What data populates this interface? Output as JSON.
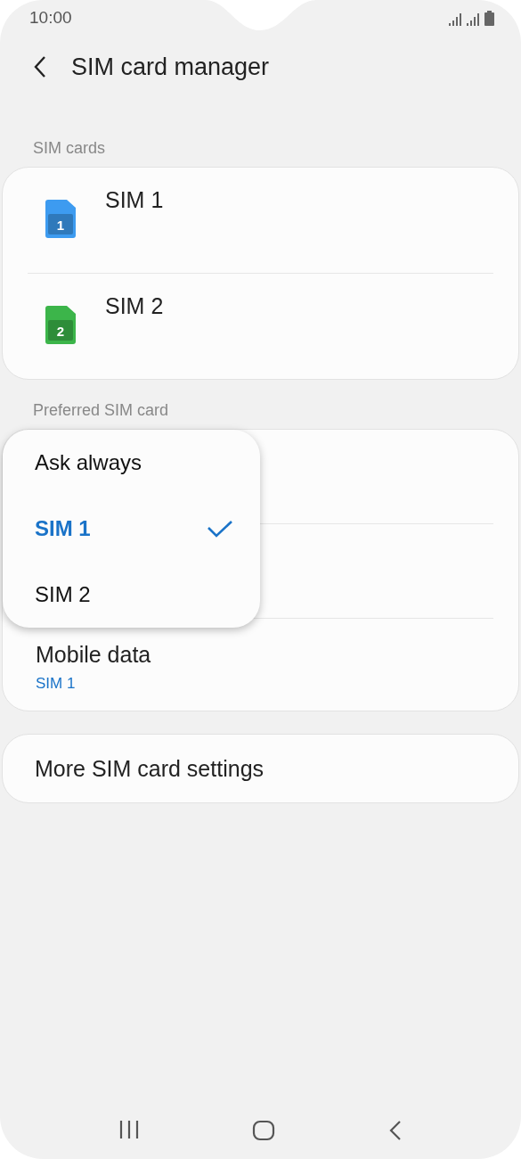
{
  "status_bar": {
    "time": "10:00"
  },
  "header": {
    "title": "SIM card manager"
  },
  "sim_cards": {
    "heading": "SIM cards",
    "items": [
      {
        "name": "SIM 1",
        "number": "1",
        "color": "#3d9bf0"
      },
      {
        "name": "SIM 2",
        "number": "2",
        "color": "#3cb54a"
      }
    ]
  },
  "preferred": {
    "heading": "Preferred SIM card",
    "rows": [
      {
        "label": "Mobile data",
        "value": "SIM 1"
      }
    ],
    "popup": [
      {
        "label": "Ask always",
        "selected": false
      },
      {
        "label": "SIM 1",
        "selected": true
      },
      {
        "label": "SIM 2",
        "selected": false
      }
    ]
  },
  "more": {
    "label": "More SIM card settings"
  }
}
